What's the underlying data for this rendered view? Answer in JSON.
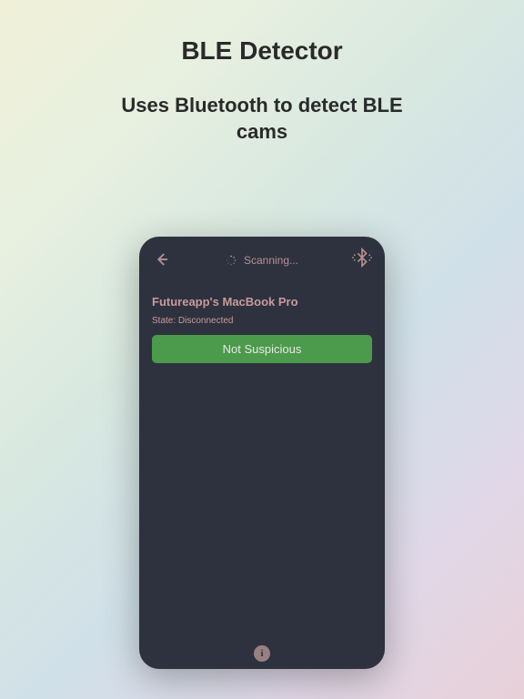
{
  "page": {
    "title": "BLE Detector",
    "subtitle_line1": "Uses Bluetooth to detect BLE",
    "subtitle_line2": "cams"
  },
  "phone": {
    "header": {
      "scanning_label": "Scanning..."
    },
    "device": {
      "name": "Futureapp's MacBook Pro",
      "state_label": "State: Disconnected",
      "status_button_label": "Not Suspicious"
    },
    "info_icon_glyph": "i"
  }
}
